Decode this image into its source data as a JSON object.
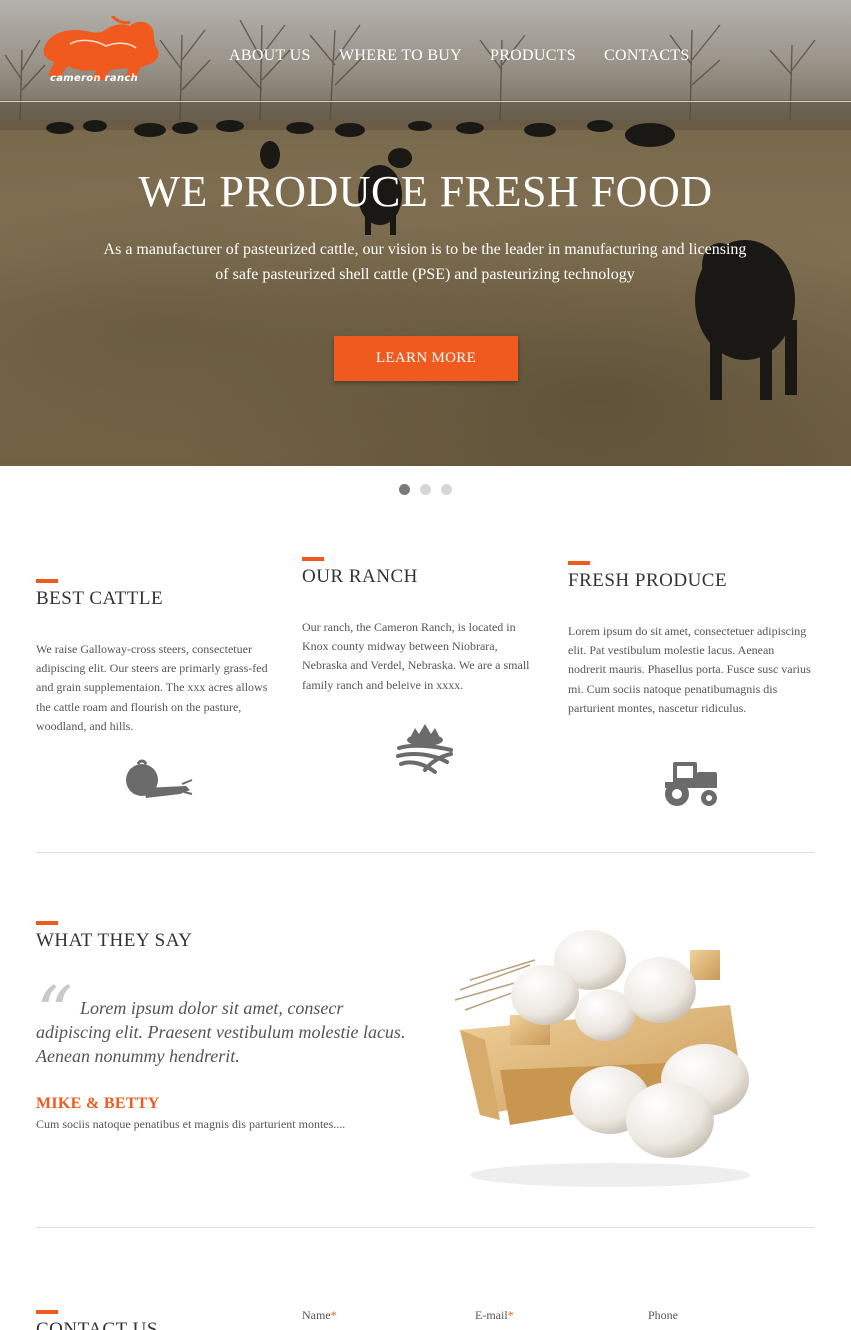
{
  "brand": {
    "name": "cameron ranch",
    "accent": "#f05a1e"
  },
  "nav": {
    "items": [
      "ABOUT US",
      "WHERE TO BUY",
      "PRODUCTS",
      "CONTACTS"
    ]
  },
  "hero": {
    "title": "WE PRODUCE FRESH FOOD",
    "subtitle": "As a manufacturer of pasteurized cattle, our vision is to be the leader in manufacturing and licensing of safe pasteurized shell cattle (PSE) and pasteurizing technology",
    "button": "LEARN MORE",
    "slides": 3,
    "active_slide": 1
  },
  "features": [
    {
      "title": "BEST CATTLE",
      "text": "We raise Galloway-cross steers, consectetuer adipiscing elit. Our steers are primarly grass-fed and grain supplementaion. The xxx acres allows the cattle roam and flourish on the pasture, woodland, and hills.",
      "icon": "vegetables-icon"
    },
    {
      "title": "OUR RANCH",
      "text": "Our ranch, the Cameron Ranch, is located in Knox county midway between Niobrara, Nebraska and Verdel, Nebraska. We are a small family ranch and beleive in xxxx.",
      "icon": "field-sunrise-icon"
    },
    {
      "title": "FRESH PRODUCE",
      "text": "Lorem ipsum do sit amet, consectetuer adipiscing elit. Pat vestibulum molestie lacus. Aenean nodrerit mauris. Phasellus porta. Fusce susc varius mi. Cum sociis natoque penatibumagnis dis parturient montes, nascetur ridiculus.",
      "icon": "tractor-icon"
    }
  ],
  "testimonial": {
    "title": "WHAT THEY SAY",
    "quote": "Lorem ipsum dolor sit amet, consecr adipiscing elit. Praesent vestibulum molestie lacus. Aenean nonummy hendrerit.",
    "author": "MIKE & BETTY",
    "author_note": "Cum sociis natoque penatibus et magnis dis parturient montes...."
  },
  "contact": {
    "title": "CONTACT US",
    "fields": [
      {
        "label": "Name",
        "required": true
      },
      {
        "label": "E-mail",
        "required": true
      },
      {
        "label": "Phone",
        "required": false
      }
    ]
  }
}
